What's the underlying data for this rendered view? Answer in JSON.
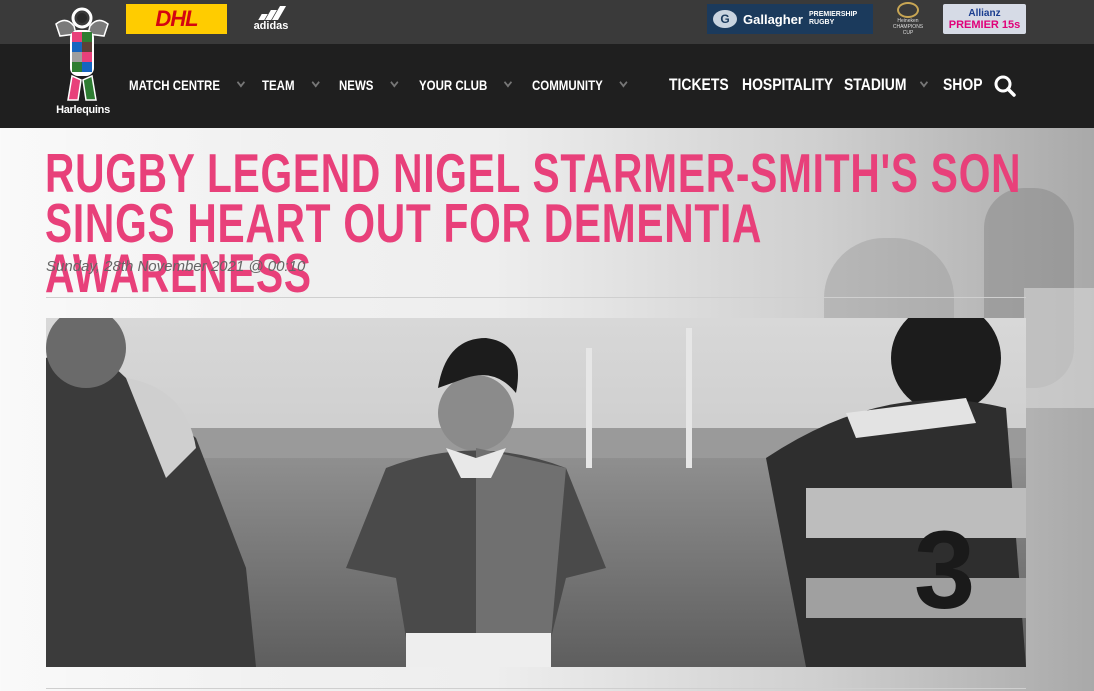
{
  "sponsors": {
    "dhl": "DHL",
    "adidas": "adidas",
    "gallagher": "Gallagher",
    "gallagher_sub": "PREMIERSHIP RUGBY",
    "champions": "Heineken CHAMPIONS CUP",
    "allianz_top": "Allianz",
    "allianz_bottom": "PREMIER 15s"
  },
  "logo": {
    "name": "Harlequins"
  },
  "nav": {
    "items": [
      {
        "label": "MATCH CENTRE"
      },
      {
        "label": "TEAM"
      },
      {
        "label": "NEWS"
      },
      {
        "label": "YOUR CLUB"
      },
      {
        "label": "COMMUNITY"
      }
    ],
    "highlight": [
      {
        "label": "TICKETS"
      },
      {
        "label": "HOSPITALITY"
      },
      {
        "label": "STADIUM"
      },
      {
        "label": "SHOP"
      }
    ],
    "search_icon": "search-icon"
  },
  "article": {
    "headline": "RUGBY LEGEND NIGEL STARMER-SMITH'S SON SINGS HEART OUT FOR DEMENTIA AWARENESS",
    "date": "Sunday, 28th November 2021 @ 00:10"
  },
  "colors": {
    "accent": "#e8407a",
    "topbar": "#3a3a3a",
    "navbar": "#1f1f1f"
  }
}
